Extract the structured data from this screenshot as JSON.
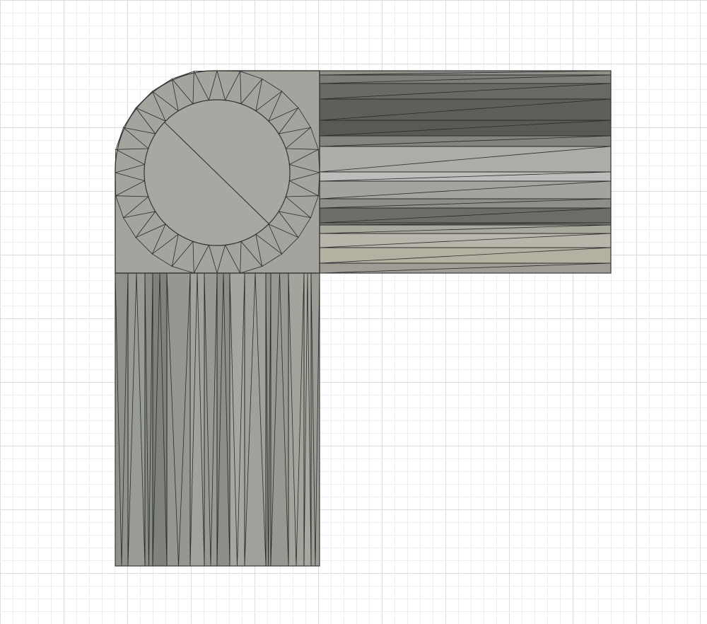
{
  "viewport": {
    "background": "#ffffff",
    "grid_minor_color": "#eeeeee",
    "grid_major_color": "#dcdcdc"
  },
  "model": {
    "name": "",
    "face_color": "#a2a49d",
    "cap_color": "#a6a8a1",
    "edge_color": "#2b2b2b",
    "horizontal_arm_band_shades": [
      "#8e908a",
      "#7d7e79",
      "#696a66",
      "#5e5f5a",
      "#595a56",
      "#83847f",
      "#abada8",
      "#bcbebb",
      "#a2a49f",
      "#8d8f8a",
      "#6c6d68",
      "#7a7b76",
      "#a8a89d",
      "#b8b6aa",
      "#b4b0a2",
      "#9f9d94"
    ],
    "vertical_arm_band_shades": [
      "#8f918c",
      "#999b95",
      "#8a8c86",
      "#7f817b",
      "#959791",
      "#a1a39d",
      "#979993",
      "#8c8e88",
      "#a4a69f",
      "#9fa19b",
      "#8e9089",
      "#969891",
      "#a5a49c",
      "#a9a8a0",
      "#9c9c95"
    ]
  }
}
